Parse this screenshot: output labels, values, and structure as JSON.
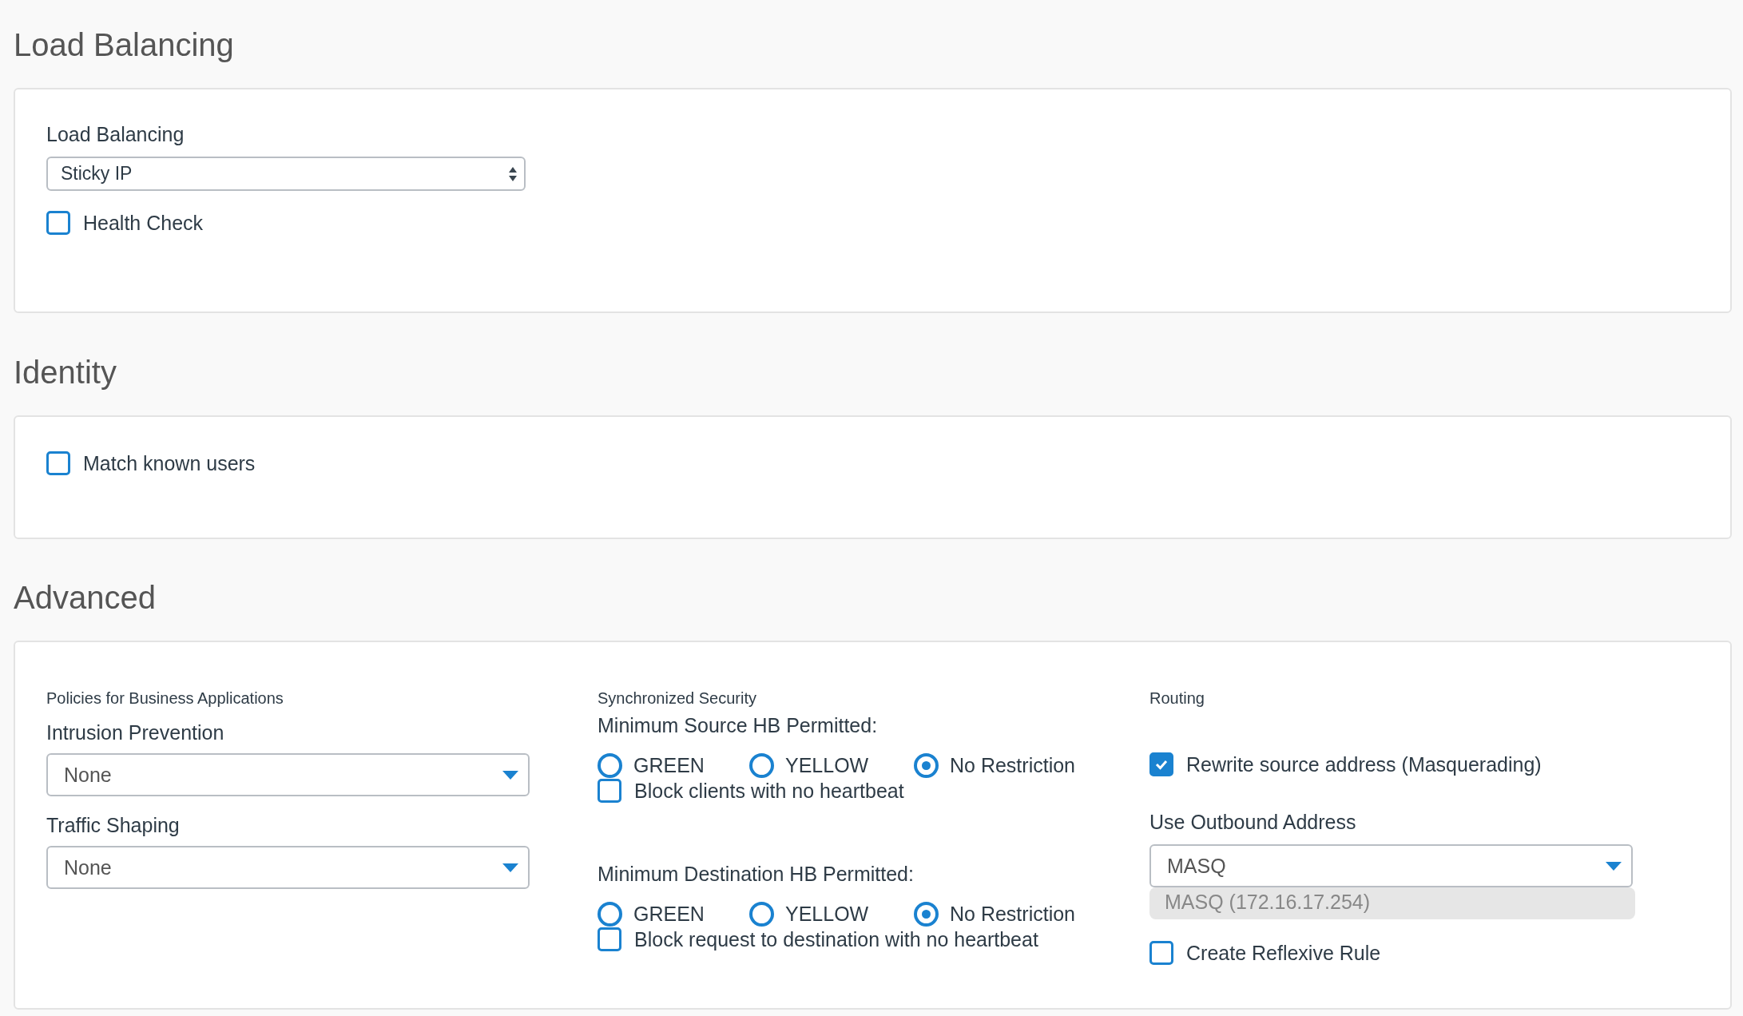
{
  "load_balancing": {
    "heading": "Load Balancing",
    "field_label": "Load Balancing",
    "select_value": "Sticky IP",
    "health_check": {
      "label": "Health Check",
      "checked": false
    }
  },
  "identity": {
    "heading": "Identity",
    "match_known_users": {
      "label": "Match known users",
      "checked": false
    }
  },
  "advanced": {
    "heading": "Advanced",
    "policies": {
      "title": "Policies for Business Applications",
      "fields": [
        {
          "label": "Intrusion Prevention",
          "value": "None"
        },
        {
          "label": "Traffic Shaping",
          "value": "None"
        }
      ]
    },
    "synchronized_security": {
      "title": "Synchronized Security",
      "groups": [
        {
          "label": "Minimum Source HB Permitted:",
          "options": [
            {
              "label": "GREEN",
              "selected": false
            },
            {
              "label": "YELLOW",
              "selected": false
            },
            {
              "label": "No Restriction",
              "selected": true
            }
          ],
          "block": {
            "label": "Block clients with no heartbeat",
            "checked": false
          }
        },
        {
          "label": "Minimum Destination HB Permitted:",
          "options": [
            {
              "label": "GREEN",
              "selected": false
            },
            {
              "label": "YELLOW",
              "selected": false
            },
            {
              "label": "No Restriction",
              "selected": true
            }
          ],
          "block": {
            "label": "Block request to destination with no heartbeat",
            "checked": false
          }
        }
      ]
    },
    "routing": {
      "title": "Routing",
      "masquerading": {
        "label": "Rewrite source address (Masquerading)",
        "checked": true
      },
      "outbound_label": "Use Outbound Address",
      "outbound_value": "MASQ",
      "outbound_option": "MASQ (172.16.17.254)",
      "reflexive": {
        "label": "Create Reflexive Rule",
        "checked": false
      }
    }
  }
}
